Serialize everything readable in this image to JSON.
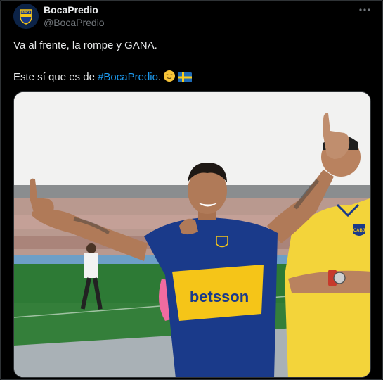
{
  "author": {
    "display_name": "BocaPredio",
    "handle": "@BocaPredio",
    "avatar_text": "BOCA"
  },
  "tweet": {
    "line1": "Va al frente, la rompe y GANA.",
    "line2_prefix": "Este sí que es de ",
    "hashtag": "#BocaPredio",
    "line2_suffix": ".",
    "emojis": [
      "relieved-face-emoji",
      "sweden-flag-emoji"
    ]
  },
  "media": {
    "sponsor_text": "betsson",
    "badge_text": "CABJ",
    "colors": {
      "boca_blue": "#1a3a8a",
      "boca_gold": "#f5c518",
      "grass": "#2d7a35",
      "hashtag_blue": "#1d9bf0"
    }
  }
}
